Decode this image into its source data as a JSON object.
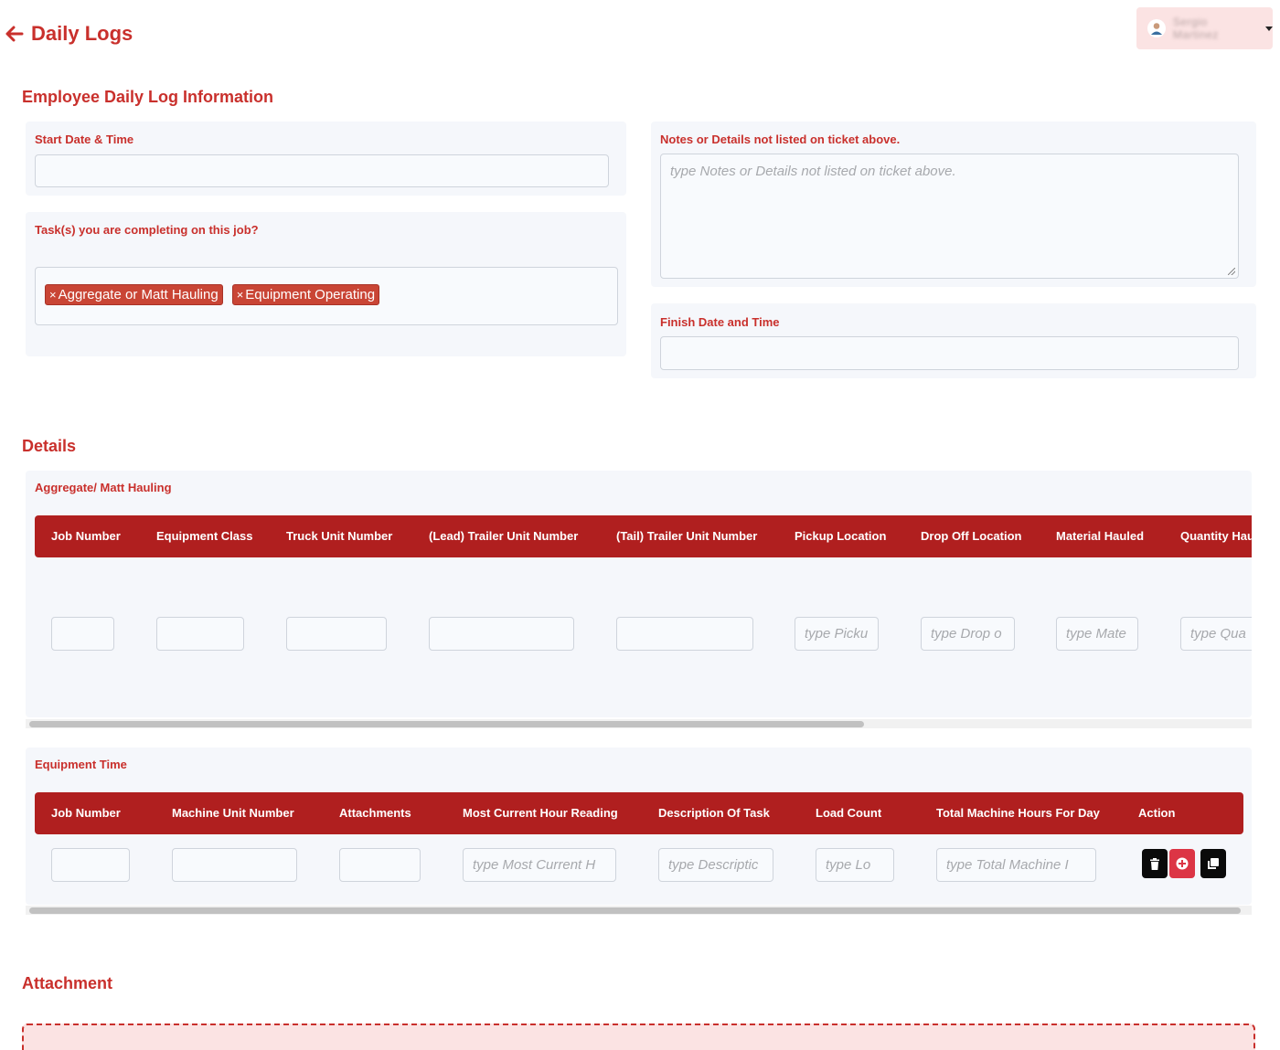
{
  "header": {
    "title": "Daily Logs",
    "user_name": "Sergio Martinez"
  },
  "info": {
    "section_title": "Employee Daily Log Information",
    "start_label": "Start Date & Time",
    "start_value": "",
    "tasks_label": "Task(s) you are completing on this job?",
    "tasks": [
      "Aggregate or Matt Hauling",
      "Equipment Operating"
    ],
    "notes_label": "Notes or Details not listed on ticket above.",
    "notes_placeholder": "type Notes or Details not listed on ticket above.",
    "finish_label": "Finish Date and Time",
    "finish_value": ""
  },
  "details": {
    "section_title": "Details",
    "hauling": {
      "title": "Aggregate/ Matt Hauling",
      "columns": [
        "Job Number",
        "Equipment Class",
        "Truck Unit Number",
        "(Lead) Trailer Unit Number",
        "(Tail) Trailer Unit Number",
        "Pickup Location",
        "Drop Off Location",
        "Material Hauled",
        "Quantity Hau"
      ],
      "placeholders": [
        "",
        "",
        "",
        "",
        "",
        "type Picku",
        "type Drop o",
        "type Mate",
        "type Qua"
      ]
    },
    "equipment": {
      "title": "Equipment Time",
      "columns": [
        "Job Number",
        "Machine Unit Number",
        "Attachments",
        "Most Current Hour Reading",
        "Description Of Task",
        "Load Count",
        "Total Machine Hours For Day",
        "Action"
      ],
      "placeholders": [
        "",
        "",
        "",
        "type Most Current  H",
        "type Descriptic",
        "type Lo",
        "type Total Machine I"
      ],
      "actions": [
        "trash-icon",
        "plus-circle-icon",
        "copy-icon"
      ]
    }
  },
  "attachment": {
    "section_title": "Attachment"
  },
  "colors": {
    "accent": "#c9302c",
    "table_header": "#b01f1f",
    "panel": "#f5f7fb",
    "danger_button": "#dc3545"
  }
}
